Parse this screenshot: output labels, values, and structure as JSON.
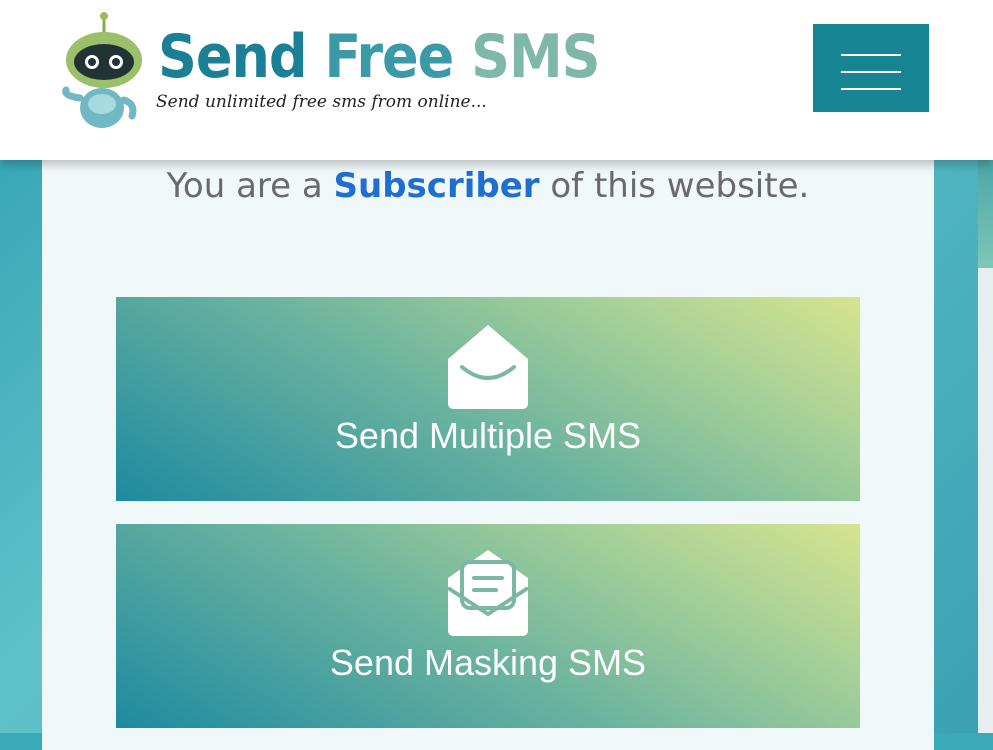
{
  "header": {
    "brand": {
      "word1": "Send",
      "word2": "Free",
      "word3": "SMS"
    },
    "tagline": "Send unlimited free sms from online...",
    "menu_button": {
      "icon": "hamburger-menu-icon",
      "color": "#168493"
    }
  },
  "main": {
    "subscriber": {
      "prefix": "You are a",
      "role": "Subscriber",
      "suffix": "of this website."
    },
    "actions": [
      {
        "label": "Send Multiple SMS",
        "icon": "envelope-open-icon"
      },
      {
        "label": "Send Masking SMS",
        "icon": "envelope-letter-icon"
      }
    ]
  },
  "colors": {
    "accent": "#168493",
    "role_text": "#1e6fd0",
    "tile_gradient_start": "#1e8aa0",
    "tile_gradient_end": "#d6e48f"
  }
}
